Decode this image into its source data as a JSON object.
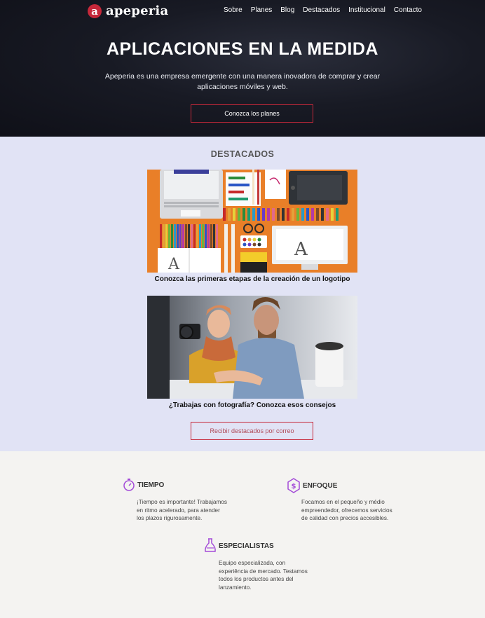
{
  "header": {
    "logo_letter": "a",
    "logo_text": "apeperia",
    "nav": [
      "Sobre",
      "Planes",
      "Blog",
      "Destacados",
      "Institucional",
      "Contacto"
    ]
  },
  "hero": {
    "title": "APLICACIONES EN LA MEDIDA",
    "subtitle": "Apeperia es una empresa emergente con una manera inovadora de comprar y crear aplicaciones móviles y web.",
    "cta_label": "Conozca los planes"
  },
  "featured": {
    "title": "DESTACADOS",
    "items": [
      {
        "caption": "Conozca las primeras etapas de la creación de un logotipo"
      },
      {
        "caption": "¿Trabajas con fotografía? Conozca esos consejos"
      }
    ],
    "subscribe_label": "Recibir destacados por correo"
  },
  "features": [
    {
      "icon": "stopwatch-icon",
      "title": "TIEMPO",
      "text": [
        "¡Tiempo es importante! Trabajamos",
        "en ritmo acelerado, para atender",
        "los plazos rigurosamente."
      ]
    },
    {
      "icon": "dollar-hexagon-icon",
      "title": "ENFOQUE",
      "text": [
        "Focamos en el pequeño y médio",
        "empreendedor, ofrecemos servicios",
        "de calidad con precios accesibles."
      ]
    },
    {
      "icon": "flask-icon",
      "title": "ESPECIALISTAS",
      "text": [
        "Equipo especializada, con",
        "experiência de mercado. Testamos",
        "todos los productos antes del",
        "lanzamiento."
      ]
    }
  ],
  "colors": {
    "accent": "#c6283a",
    "icon": "#a34bd8",
    "hero_bg": "#181a24",
    "featured_bg": "#e1e3f5",
    "footer_bg": "#f4f3f1"
  }
}
